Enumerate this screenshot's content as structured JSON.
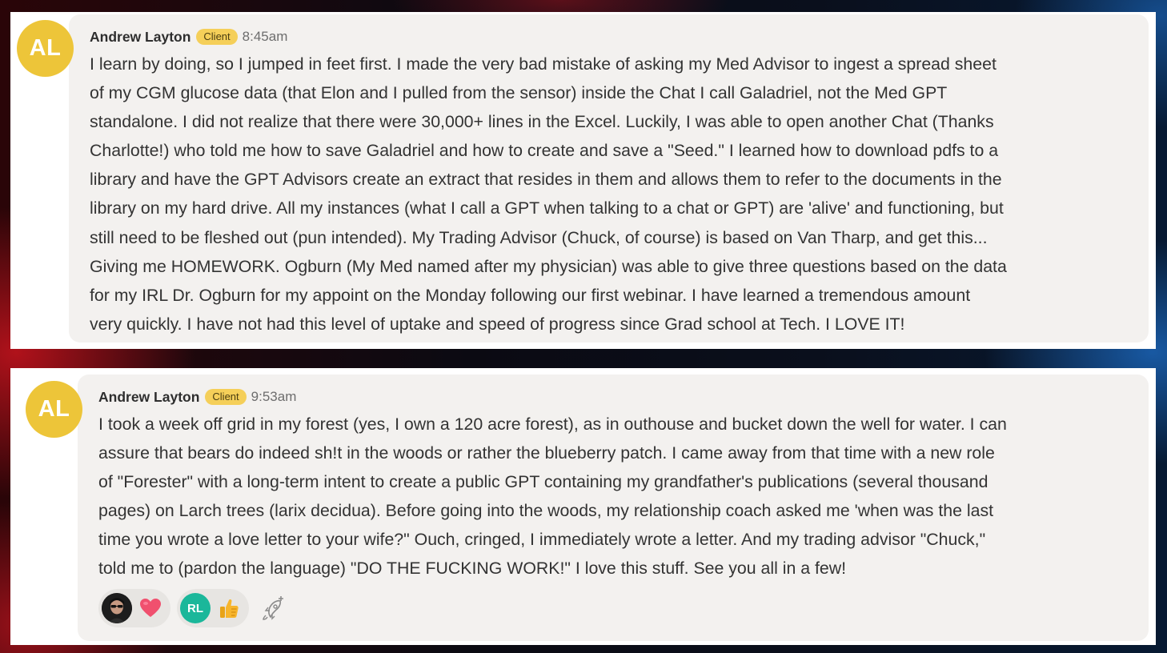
{
  "messages": [
    {
      "avatar_initials": "AL",
      "author": "Andrew Layton",
      "badge": "Client",
      "time": "8:45am",
      "text": "I learn by doing, so I jumped in feet first.  I made the very bad mistake of asking my Med Advisor to ingest a spread sheet\nof my CGM glucose data (that Elon and I pulled from the sensor) inside the Chat I call Galadriel, not the Med GPT\nstandalone. I did not realize that there were 30,000+ lines in the Excel.  Luckily, I was able to open another Chat (Thanks\nCharlotte!) who told me how to save Galadriel and how to create and save a \"Seed.\"  I learned how to download pdfs to a\nlibrary and have the GPT Advisors create an extract that resides in them and allows them to refer to the documents in the\nlibrary on my hard drive. All my instances (what I call a GPT when talking to a chat or GPT) are 'alive' and functioning, but\nstill need to be fleshed out (pun intended).  My Trading Advisor (Chuck, of course) is based on Van Tharp, and get this...\nGiving me HOMEWORK. Ogburn (My Med named after my physician) was able to give three questions based on the data\nfor my IRL Dr. Ogburn for my appoint on the Monday following our first webinar.  I have learned a tremendous amount\nvery quickly.  I have not had this level of uptake and speed of progress since Grad school at Tech. I LOVE IT!"
    },
    {
      "avatar_initials": "AL",
      "author": "Andrew Layton",
      "badge": "Client",
      "time": "9:53am",
      "text": "I took a week off grid in my forest (yes, I own a 120 acre forest), as in outhouse and bucket down the well for water.  I can\nassure that bears do indeed sh!t in the woods or rather the blueberry patch.  I came away from that time with a new role\nof \"Forester\" with a long-term intent to create a public GPT containing my grandfather's publications (several thousand\npages) on Larch trees (larix decidua).   Before going into the woods, my relationship coach asked me 'when was the last\ntime you wrote a love letter to your wife?\"  Ouch, cringed, I immediately wrote a letter.  And my trading advisor \"Chuck,\"\ntold me to (pardon the language) \"DO THE FUCKING WORK!\"  I love this stuff. See you all in a few!",
      "reactions": [
        {
          "user_initials": "",
          "user_avatar": "photo-avatar",
          "emoji": "heart-icon"
        },
        {
          "user_initials": "RL",
          "user_avatar": "initials-avatar",
          "emoji": "thumbs-up-icon"
        }
      ],
      "add_reaction_icon": "add-reaction-icon"
    }
  ],
  "colors": {
    "avatar": "#edc539",
    "badge": "#f5cf59",
    "bubble": "#f3f1ef",
    "rl_avatar": "#1bb79a",
    "heart": "#f0506e"
  }
}
